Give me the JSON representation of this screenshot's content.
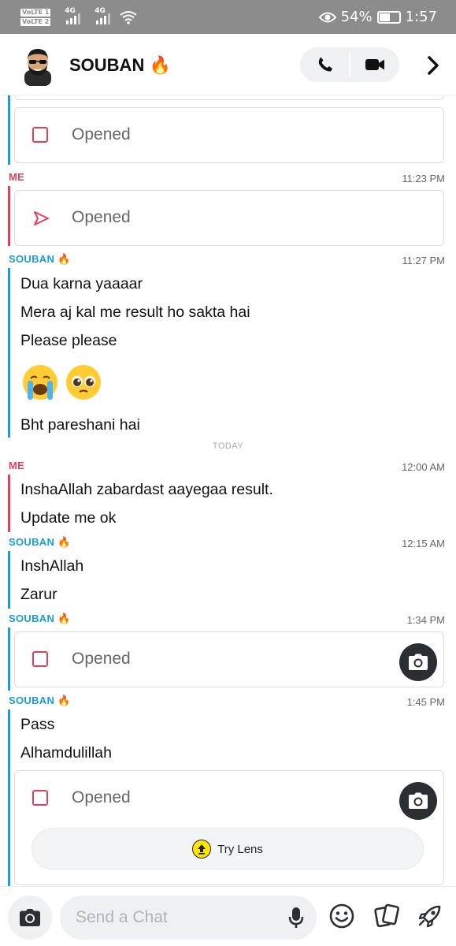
{
  "status_bar": {
    "volte1": "VoLTE 1",
    "volte2": "VoLTE 2",
    "net1": "4G",
    "net2": "4G",
    "battery_percent": "54%",
    "battery_level": 0.54,
    "time": "1:57"
  },
  "header": {
    "contact_name": "SOUBAN 🔥",
    "icons": [
      "avatar",
      "phone-icon",
      "video-icon",
      "chevron-right-icon"
    ]
  },
  "chat": {
    "opened_label": "Opened",
    "today_label": "TODAY",
    "groups": [
      {
        "sender": "ME",
        "time": "11:23 PM"
      },
      {
        "sender": "SOUBAN 🔥",
        "time": "11:27 PM",
        "messages": [
          "Dua karna yaaaar",
          "Mera aj kal me result ho sakta hai",
          "Please please",
          "Bht pareshani hai"
        ],
        "emojis": [
          "crying-face",
          "pleading-face"
        ]
      },
      {
        "sender": "ME",
        "time": "12:00 AM",
        "messages": [
          "InshaAllah zabardast aayegaa result.",
          "Update me ok"
        ]
      },
      {
        "sender": "SOUBAN 🔥",
        "time": "12:15 AM",
        "messages": [
          "InshAllah",
          "Zarur"
        ]
      },
      {
        "sender": "SOUBAN 🔥",
        "time": "1:34 PM"
      },
      {
        "sender": "SOUBAN 🔥",
        "time": "1:45 PM",
        "messages": [
          "Pass",
          "Alhamdulillah"
        ]
      }
    ],
    "try_lens_label": "Try Lens"
  },
  "composer": {
    "placeholder": "Send a Chat",
    "icons": [
      "camera-icon",
      "mic-icon",
      "smiley-icon",
      "stickers-icon",
      "rocket-icon"
    ]
  },
  "colors": {
    "snap_blue": "#1a9dd9",
    "snap_red": "#e64058",
    "status_gray": "#8c8c8c"
  }
}
